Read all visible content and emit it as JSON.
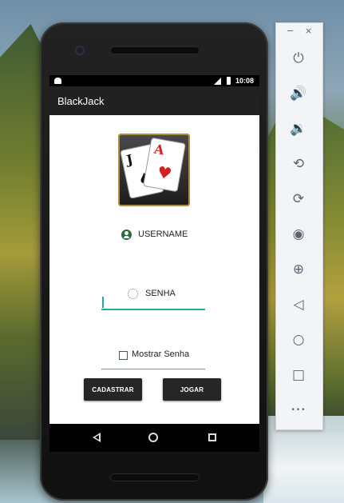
{
  "status_bar": {
    "time": "10:08"
  },
  "app": {
    "title": "BlackJack"
  },
  "login": {
    "username_label": "USERNAME",
    "username_value": "",
    "password_label": "SENHA",
    "password_value": "",
    "show_password_label": "Mostrar Senha",
    "show_password_checked": false,
    "register_button": "CADASTRAR",
    "play_button": "JOGAR"
  },
  "logo": {
    "card1_rank": "J",
    "card1_suit": "♠",
    "card2_rank": "A",
    "card2_suit": "♥"
  },
  "emulator_toolbar": {
    "minimize": "−",
    "close": "×",
    "buttons": [
      {
        "icon": "power-icon",
        "glyph": "⏻"
      },
      {
        "icon": "volume-up-icon",
        "glyph": "🔊"
      },
      {
        "icon": "volume-down-icon",
        "glyph": "🔉"
      },
      {
        "icon": "rotate-left-icon",
        "glyph": "⟲"
      },
      {
        "icon": "rotate-right-icon",
        "glyph": "⟳"
      },
      {
        "icon": "camera-icon",
        "glyph": "◉"
      },
      {
        "icon": "zoom-icon",
        "glyph": "⊕"
      },
      {
        "icon": "back-icon",
        "glyph": "◁"
      },
      {
        "icon": "home-icon",
        "glyph": "○"
      },
      {
        "icon": "overview-icon",
        "glyph": "□"
      },
      {
        "icon": "more-icon",
        "glyph": "•••"
      }
    ]
  },
  "colors": {
    "accent": "#2aa89a",
    "app_bar": "#212121",
    "button": "#262626",
    "icon_green": "#2e6b3a"
  }
}
